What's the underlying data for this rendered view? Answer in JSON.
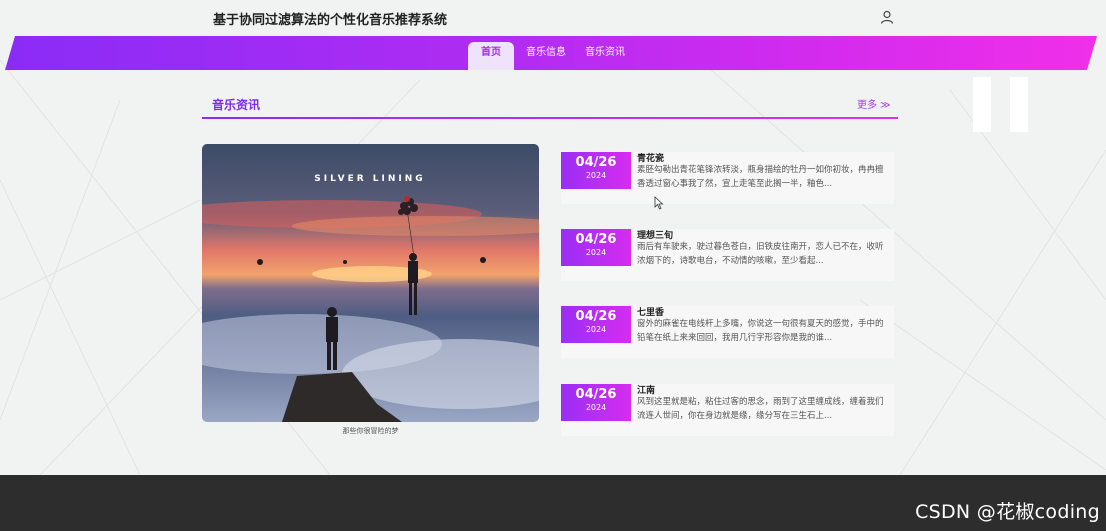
{
  "header": {
    "site_title": "基于协同过滤算法的个性化音乐推荐系统",
    "user_icon": "user-icon"
  },
  "nav": {
    "items": [
      {
        "label": "首页",
        "active": true
      },
      {
        "label": "音乐信息",
        "active": false
      },
      {
        "label": "音乐资讯",
        "active": false
      }
    ]
  },
  "section": {
    "title": "音乐资讯",
    "more_label": "更多 ≫"
  },
  "feature": {
    "image_text": "SILVER LINING",
    "caption": "那些你很冒险的梦"
  },
  "news": [
    {
      "day": "04/26",
      "year": "2024",
      "title": "青花瓷",
      "excerpt": "素胚勾勒出青花笔锋浓转淡，瓶身描绘的牡丹一如你初妆，冉冉檀香透过窗心事我了然，宣上走笔至此搁一半，釉色..."
    },
    {
      "day": "04/26",
      "year": "2024",
      "title": "理想三旬",
      "excerpt": "雨后有车驶来，驶过暮色苍白，旧铁皮往南开，恋人已不在，收听浓烟下的，诗歌电台，不动情的咳嗽，至少看起..."
    },
    {
      "day": "04/26",
      "year": "2024",
      "title": "七里香",
      "excerpt": "窗外的麻雀在电线杆上多嘴，你说这一句很有夏天的感觉，手中的铅笔在纸上来来回回，我用几行字形容你是我的谁..."
    },
    {
      "day": "04/26",
      "year": "2024",
      "title": "江南",
      "excerpt": "风到这里就是粘，粘住过客的思念，雨到了这里缠成线，缠着我们流连人世间，你在身边就是缘，缘分写在三生石上..."
    }
  ],
  "watermark": "CSDN @花椒coding",
  "colors": {
    "accent_start": "#8a2cf6",
    "accent_end": "#f02fe9",
    "title": "#7d2bf2",
    "footer": "#2d2d2d"
  }
}
